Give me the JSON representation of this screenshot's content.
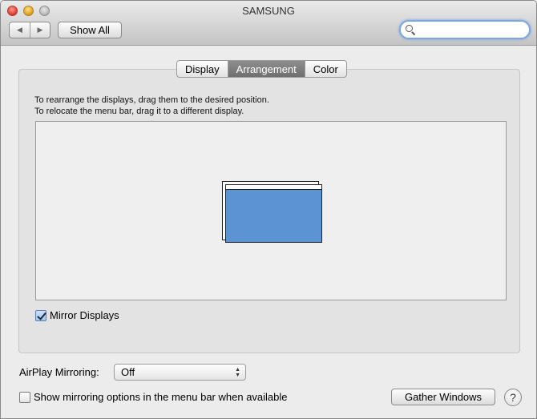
{
  "window": {
    "title": "SAMSUNG"
  },
  "toolbar": {
    "back_icon": "back-arrow-icon",
    "forward_icon": "forward-arrow-icon",
    "show_all_label": "Show All",
    "search": {
      "value": "",
      "placeholder": ""
    }
  },
  "tabs": [
    {
      "label": "Display",
      "active": false
    },
    {
      "label": "Arrangement",
      "active": true
    },
    {
      "label": "Color",
      "active": false
    }
  ],
  "instructions": {
    "line1": "To rearrange the displays, drag them to the desired position.",
    "line2": "To relocate the menu bar, drag it to a different display."
  },
  "arrangement": {
    "display_color": "#5b93d3",
    "display_count": 2
  },
  "mirror_displays": {
    "label": "Mirror Displays",
    "checked": true
  },
  "airplay": {
    "label": "AirPlay Mirroring:",
    "selected": "Off"
  },
  "show_mirroring_options": {
    "label": "Show mirroring options in the menu bar when available",
    "checked": false
  },
  "buttons": {
    "gather_windows": "Gather Windows",
    "help": "?"
  }
}
